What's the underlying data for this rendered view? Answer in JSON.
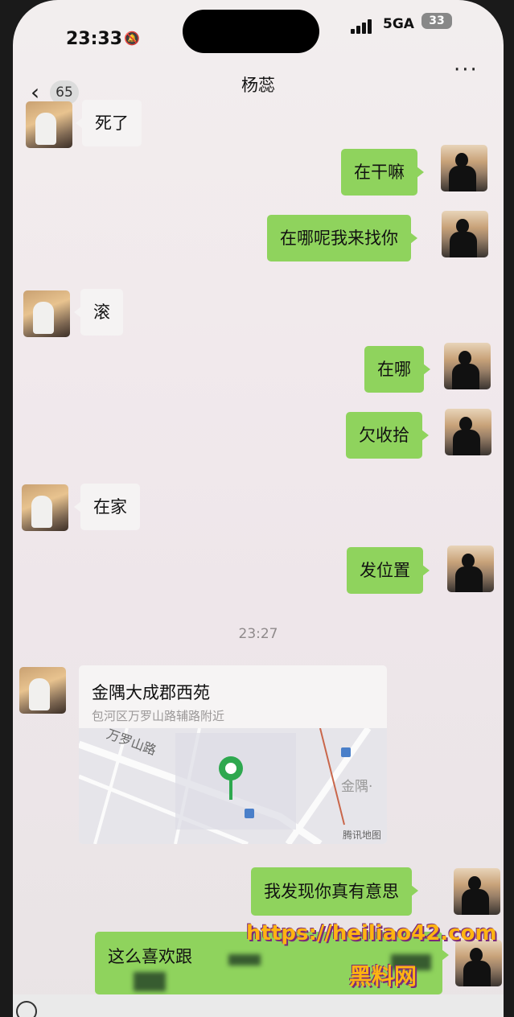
{
  "status_bar": {
    "time": "23:33",
    "network": "5GA",
    "battery": "33"
  },
  "nav": {
    "back_count": "65",
    "title": "杨蕊",
    "more": "···"
  },
  "messages": {
    "m1": "死了",
    "m2": "在干嘛",
    "m3": "在哪呢我来找你",
    "m4": "滚",
    "m5": "在哪",
    "m6": "欠收拾",
    "m7": "在家",
    "m8": "发位置",
    "m9": "我发现你真有意思",
    "m10": "这么喜欢跟"
  },
  "timestamp": "23:27",
  "location": {
    "name": "金隅大成郡西苑",
    "address": "包河区万罗山路辅路附近",
    "street_label": "万罗山路",
    "poi_label": "金隅·",
    "map_provider": "腾讯地图"
  },
  "watermark": {
    "url": "https://heiliao42.com",
    "name": "黑料网"
  },
  "colors": {
    "bubble_mine": "#8fd35d",
    "bubble_theirs": "#f5f3f3",
    "watermark": "#ffb412"
  }
}
